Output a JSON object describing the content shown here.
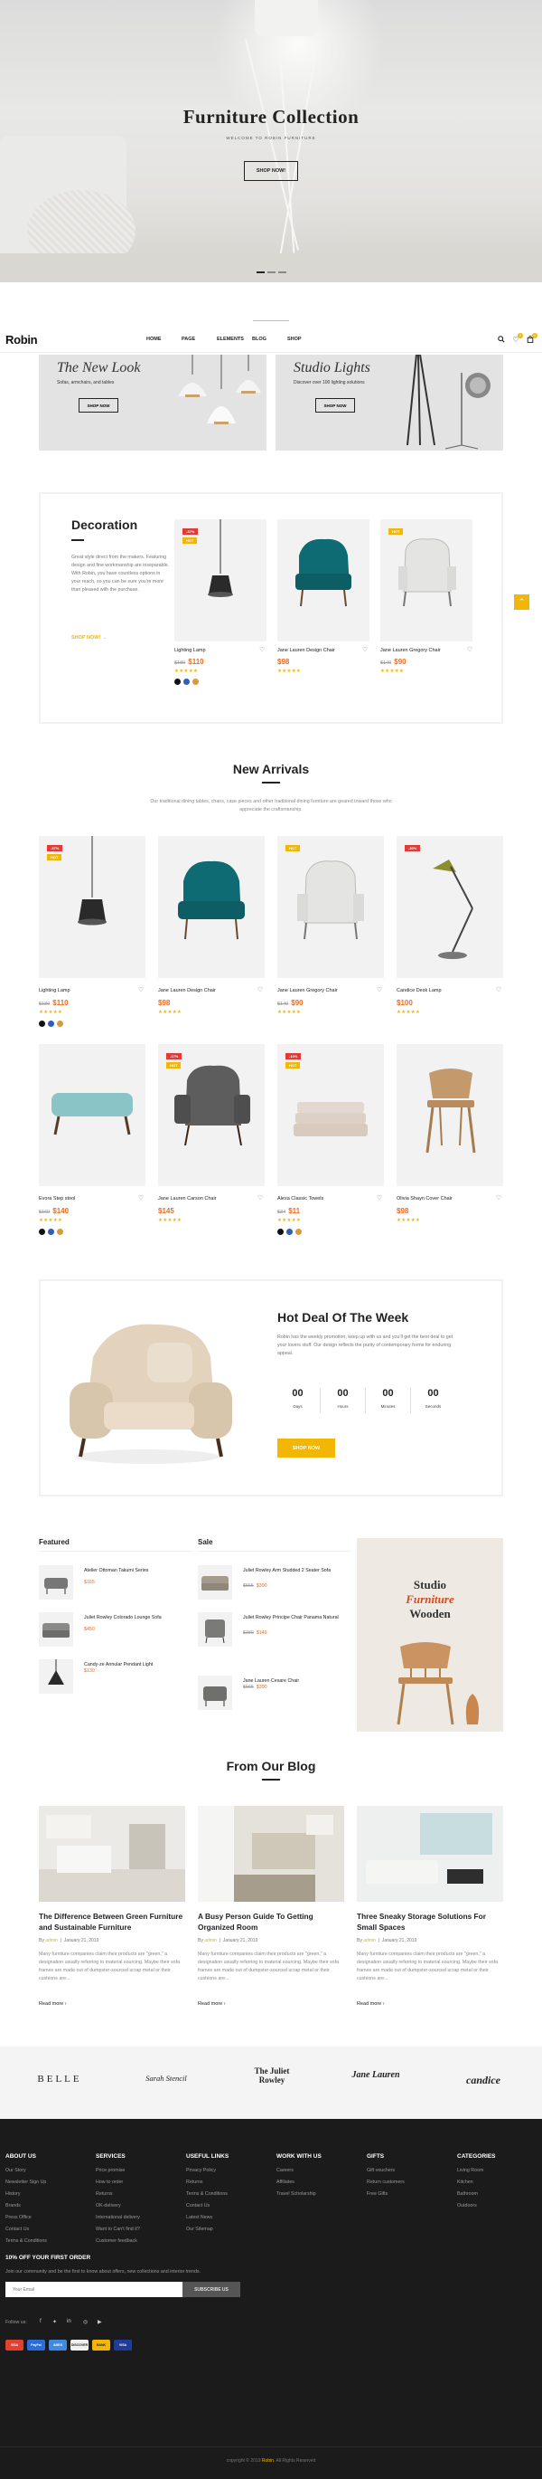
{
  "hero": {
    "title": "Furniture Collection",
    "subtitle": "WELCOME TO ROBIN FURNITURE",
    "button": "SHOP NOW!"
  },
  "header": {
    "logo": "Robin",
    "nav": [
      "HOME",
      "PAGE",
      "ELEMENTS",
      "BLOG",
      "SHOP"
    ],
    "wishlist_count": "0",
    "cart_count": "0",
    "icons": [
      "search-icon",
      "heart-icon",
      "cart-icon"
    ]
  },
  "banners": [
    {
      "title": "The New Look",
      "subtitle": "Sofas, armchairs, and tables",
      "button": "SHOP NOW"
    },
    {
      "title": "Studio Lights",
      "subtitle": "Discover over 100 lighting solutions",
      "button": "SHOP NOW"
    }
  ],
  "decoration": {
    "title": "Decoration",
    "text": "Great style direct from the makers. Featuring design and fine workmanship are inseparable. With Robin, you have countless options in your reach, so you can be sure you're more than pleased with the purchase.",
    "link": "SHOP NOW! →",
    "products": [
      {
        "name": "Lighting Lamp",
        "old": "$180",
        "price": "$110",
        "tags": [
          "-37%",
          "HOT"
        ],
        "stars": "★★★★★"
      },
      {
        "name": "Jane Lauren Design Chair",
        "old": "",
        "price": "$98",
        "tags": [],
        "stars": "★★★★★"
      },
      {
        "name": "Jane Lauren Gregory Chair",
        "old": "$140",
        "price": "$90",
        "tags": [
          "HOT"
        ],
        "stars": "★★★★★"
      }
    ]
  },
  "new_arrivals": {
    "title": "New Arrivals",
    "description": "Our traditional dining tables, chairs, case pieces and other traditional dining furniture are geared toward those who appreciate the craftsmanship.",
    "products": [
      {
        "name": "Lighting Lamp",
        "old": "$180",
        "price": "$110",
        "tags": [
          "-37%",
          "HOT"
        ],
        "stars": "★★★★★"
      },
      {
        "name": "Jane Lauren Design Chair",
        "old": "",
        "price": "$98",
        "tags": [],
        "stars": "★★★★★"
      },
      {
        "name": "Jane Lauren Gregory Chair",
        "old": "$140",
        "price": "$90",
        "tags": [
          "HOT"
        ],
        "stars": "★★★★★"
      },
      {
        "name": "Candice Desk Lamp",
        "old": "",
        "price": "$100",
        "tags": [
          "-30%"
        ],
        "stars": "★★★★★"
      },
      {
        "name": "Evora Step stool",
        "old": "$160",
        "price": "$140",
        "tags": [],
        "stars": "★★★★★"
      },
      {
        "name": "Jane Lauren Carson Chair",
        "old": "",
        "price": "$145",
        "tags": [
          "-17%",
          "HOT"
        ],
        "stars": "★★★★★"
      },
      {
        "name": "Alexa Classic Towels",
        "old": "$34",
        "price": "$11",
        "tags": [
          "-10%",
          "HOT"
        ],
        "stars": "★★★★★"
      },
      {
        "name": "Olivia Shayn Cover Chair",
        "old": "",
        "price": "$98",
        "tags": [],
        "stars": "★★★★★"
      }
    ]
  },
  "deal": {
    "title": "Hot Deal Of The Week",
    "text": "Robin has the weekly promotion, keep up with us and you'll get the best deal to get your lovers stuff. Our design reflects the purity of contemporary forms for enduring appeal.",
    "countdown": [
      {
        "value": "00",
        "label": "Days"
      },
      {
        "value": "00",
        "label": "Hours"
      },
      {
        "value": "00",
        "label": "Minutes"
      },
      {
        "value": "00",
        "label": "Seconds"
      }
    ],
    "button": "SHOP NOW"
  },
  "featured": {
    "title": "Featured",
    "items": [
      {
        "name": "Atelier Ottoman Takumi Series",
        "old": "",
        "price": "$165"
      },
      {
        "name": "Juliet Rowley Colorado Lounge Sofa",
        "old": "",
        "price": "$450"
      },
      {
        "name": "Candy-ze Annular Pendant Light",
        "old": "",
        "price": "$130"
      }
    ]
  },
  "sale": {
    "title": "Sale",
    "items": [
      {
        "name": "Juliet Rowley Arm Studded 2 Seater Sofa",
        "old": "$565",
        "price": "$390"
      },
      {
        "name": "Juliet Rowley Principe Chair Panama Natural",
        "old": "$380",
        "price": "$149"
      },
      {
        "name": "Jane Lauren Cesare Chair",
        "old": "$565",
        "price": "$390"
      }
    ]
  },
  "promo": {
    "line1": "Studio",
    "line2": "Furniture",
    "line3": "Wooden"
  },
  "blog": {
    "title": "From Our Blog",
    "posts": [
      {
        "title": "The Difference Between Green Furniture and Sustainable Furniture",
        "author": "admin",
        "date": "January 21, 2019",
        "text": "Many furniture companies claim their products are \"green,\" a designation usually referring to material sourcing. Maybe their sofa frames are made out of dumpster-sourced scrap metal or their cushions are...",
        "more": "Read more ›"
      },
      {
        "title": "A Busy Person Guide To Getting Organized Room",
        "author": "admin",
        "date": "January 21, 2019",
        "text": "Many furniture companies claim their products are \"green,\" a designation usually referring to material sourcing. Maybe their sofa frames are made out of dumpster-sourced scrap metal or their cushions are...",
        "more": "Read more ›"
      },
      {
        "title": "Three Sneaky Storage Solutions For Small Spaces",
        "author": "admin",
        "date": "January 21, 2019",
        "text": "Many furniture companies claim their products are \"green,\" a designation usually referring to material sourcing. Maybe their sofa frames are made out of dumpster-sourced scrap metal or their cushions are...",
        "more": "Read more ›"
      }
    ]
  },
  "brands": [
    "BELLE",
    "Sarah Stencil",
    "The Juliet Rowley",
    "Jane Lauren",
    "candice"
  ],
  "footer": {
    "columns": [
      {
        "title": "ABOUT US",
        "links": [
          "Our Story",
          "Newsletter Sign Up",
          "History",
          "Brands",
          "Press Office",
          "Contact Us",
          "Terms & Conditions",
          "Privacy Policy"
        ]
      },
      {
        "title": "SERVICES",
        "links": [
          "Price promise",
          "How to order",
          "Returns",
          "OK-delivery",
          "International delivery",
          "Want to Can't find it?",
          "Customer feedback",
          "Measuring Advice"
        ]
      },
      {
        "title": "USEFUL LINKS",
        "links": [
          "Privacy Policy",
          "Returns",
          "Terms & Conditions",
          "Contact Us",
          "Latest News",
          "Our Sitemap"
        ]
      },
      {
        "title": "WORK WITH US",
        "links": [
          "Careers",
          "Affiliates",
          "Travel Scholarship"
        ]
      },
      {
        "title": "GIFTS",
        "links": [
          "Gift vouchers",
          "Return customers",
          "Free Gifts"
        ]
      },
      {
        "title": "CATEGORIES",
        "links": [
          "Living Room",
          "Kitchen",
          "Bathroom",
          "Outdoors"
        ]
      }
    ],
    "offer_title": "10% OFF YOUR FIRST ORDER",
    "offer_text": "Join our community and be the first to know about offers, new collections and interior trends.",
    "email_placeholder": "Your Email",
    "subscribe": "SUBSCRIBE US",
    "follow": "Follow us:",
    "payments": [
      "VISA",
      "PayPal",
      "AMEX",
      "DISCOVER",
      "BANK",
      "VISA"
    ],
    "copyright_pre": "copyright © 2019 ",
    "copyright_brand": "Robin",
    "copyright_post": ". All Rights Reserved"
  }
}
